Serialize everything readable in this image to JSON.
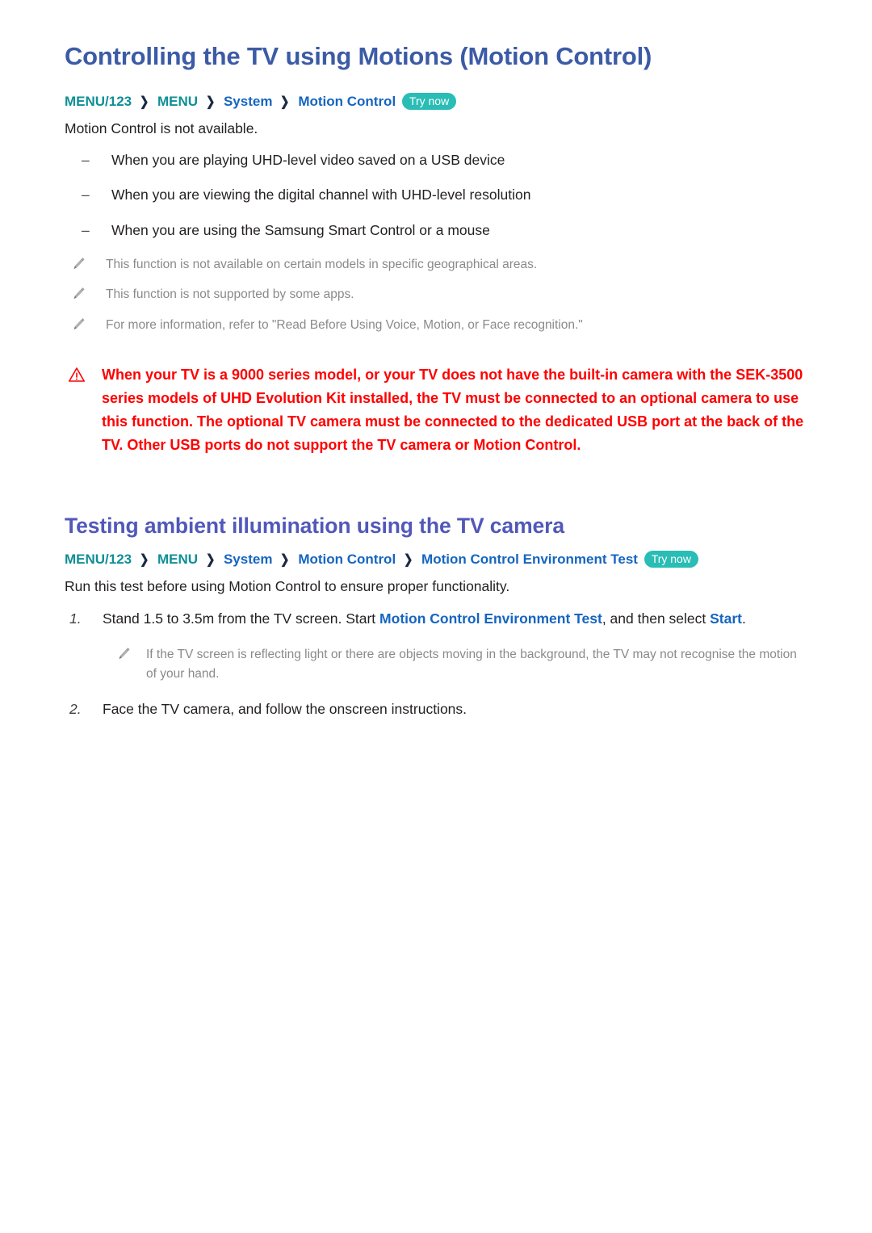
{
  "sections": [
    {
      "heading": "Controlling the TV using Motions (Motion Control)",
      "breadcrumb": {
        "items": [
          {
            "label": "MENU/123",
            "style": "teal"
          },
          {
            "label": "MENU",
            "style": "teal"
          },
          {
            "label": "System",
            "style": "blue"
          },
          {
            "label": "Motion Control",
            "style": "blue"
          }
        ],
        "separator": "❯",
        "badge": "Try now"
      },
      "intro": "Motion Control is not available.",
      "dash_items": [
        "When you are playing UHD-level video saved on a USB device",
        "When you are viewing the digital channel with UHD-level resolution",
        "When you are using the Samsung Smart Control or a mouse"
      ],
      "notes": [
        "This function is not available on certain models in specific geographical areas.",
        "This function is not supported by some apps.",
        "For more information, refer to \"Read Before Using Voice, Motion, or Face recognition.\""
      ],
      "warning": "When your TV is a 9000 series model, or your TV does not have the built-in camera with the SEK-3500 series models of UHD Evolution Kit installed, the TV must be connected to an optional camera to use this function. The optional TV camera must be connected to the dedicated USB port at the back of the TV. Other USB ports do not support the TV camera or Motion Control."
    },
    {
      "heading": "Testing ambient illumination using the TV camera",
      "breadcrumb": {
        "items": [
          {
            "label": "MENU/123",
            "style": "teal"
          },
          {
            "label": "MENU",
            "style": "teal"
          },
          {
            "label": "System",
            "style": "blue"
          },
          {
            "label": "Motion Control",
            "style": "blue"
          },
          {
            "label": "Motion Control Environment Test",
            "style": "blue"
          }
        ],
        "separator": "❯",
        "badge": "Try now"
      },
      "intro": "Run this test before using Motion Control to ensure proper functionality.",
      "steps": [
        {
          "number": "1.",
          "text_before": "Stand 1.5 to 3.5m from the TV screen. Start ",
          "link1": "Motion Control Environment Test",
          "text_middle": ", and then select ",
          "link2": "Start",
          "text_after": "."
        },
        {
          "number": "2.",
          "text_before": "Face the TV camera, and follow the onscreen instructions.",
          "link1": "",
          "text_middle": "",
          "link2": "",
          "text_after": ""
        }
      ],
      "step_note": "If the TV screen is reflecting light or there are objects moving in the background, the TV may not recognise the motion of your hand."
    }
  ],
  "icons": {
    "pencil": "pencil-icon",
    "warning": "warning-triangle-icon"
  },
  "colors": {
    "heading1": "#3c5ba6",
    "heading2": "#5158b8",
    "teal": "#0f8f96",
    "blue": "#1565c0",
    "badge_bg": "#29bdb5",
    "warning": "#ff0000",
    "note": "#8a8a8a",
    "body": "#231f20"
  },
  "markers": {
    "dash": "–"
  }
}
